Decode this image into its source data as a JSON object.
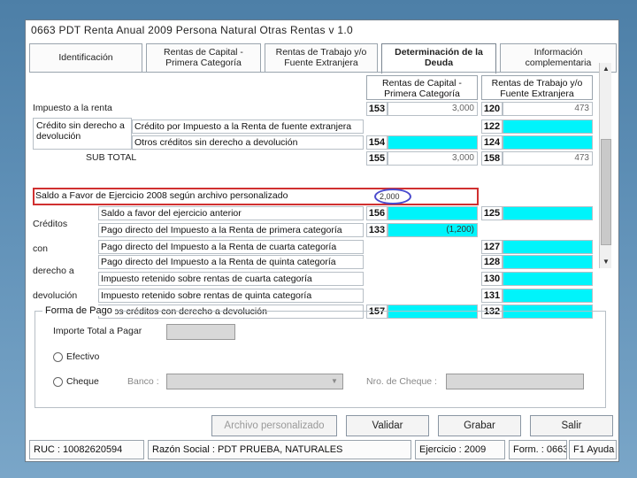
{
  "window": {
    "title": "0663 PDT Renta Anual 2009   Persona Natural   Otras Rentas   v 1.0"
  },
  "tabs": [
    {
      "label": "Identificación"
    },
    {
      "label": "Rentas de Capital - Primera Categoría"
    },
    {
      "label": "Rentas de Trabajo y/o Fuente Extranjera"
    },
    {
      "label": "Determinación de la Deuda"
    },
    {
      "label": "Información complementaria"
    }
  ],
  "columns": {
    "primera": "Rentas de Capital - Primera Categoría",
    "trabajo": "Rentas de Trabajo y/o Fuente Extranjera"
  },
  "impuesto": {
    "label": "Impuesto a la renta",
    "code1": "153",
    "value1": "3,000",
    "code2": "120",
    "value2": "473"
  },
  "credito_sin_derecho": {
    "group_label": "Crédito sin derecho a devolución",
    "rows": [
      {
        "label": "Crédito por Impuesto a la Renta de fuente extranjera",
        "code1": "",
        "value1": "",
        "code2": "122",
        "value2": ""
      },
      {
        "label": "Otros créditos sin derecho a devolución",
        "code1": "154",
        "value1": "",
        "code2": "124",
        "value2": ""
      }
    ]
  },
  "subtotal": {
    "label": "SUB TOTAL",
    "code1": "155",
    "value1": "3,000",
    "code2": "158",
    "value2": "473"
  },
  "saldo": {
    "label": "Saldo a Favor de Ejercicio 2008 según archivo personalizado",
    "value": "2,000"
  },
  "creditos_con_derecho": {
    "group_words": [
      "Créditos",
      "con",
      "derecho a",
      "devolución"
    ],
    "rows": [
      {
        "label": "Saldo a favor del ejercicio anterior",
        "code1": "156",
        "value1": "",
        "code2": "125",
        "value2": ""
      },
      {
        "label": "Pago directo del Impuesto a la Renta de primera categoría",
        "code1": "133",
        "value1": "(1,200)",
        "code2": "",
        "value2": ""
      },
      {
        "label": "Pago directo del Impuesto a la Renta de cuarta categoría",
        "code1": "",
        "value1": "",
        "code2": "127",
        "value2": ""
      },
      {
        "label": "Pago directo del Impuesto a la Renta de quinta categoría",
        "code1": "",
        "value1": "",
        "code2": "128",
        "value2": ""
      },
      {
        "label": "Impuesto retenido sobre rentas de cuarta categoría",
        "code1": "",
        "value1": "",
        "code2": "130",
        "value2": ""
      },
      {
        "label": "Impuesto retenido sobre rentas de quinta categoría",
        "code1": "",
        "value1": "",
        "code2": "131",
        "value2": ""
      },
      {
        "label": "Otros créditos con derecho a devolución",
        "code1": "157",
        "value1": "",
        "code2": "132",
        "value2": ""
      }
    ]
  },
  "forma_pago": {
    "legend": "Forma de Pago",
    "importe_label": "Importe Total a Pagar",
    "efectivo_label": "Efectivo",
    "cheque_label": "Cheque",
    "banco_label": "Banco :",
    "nro_cheque_label": "Nro. de Cheque :"
  },
  "buttons": {
    "archivo": "Archivo personalizado",
    "validar": "Validar",
    "grabar": "Grabar",
    "salir": "Salir"
  },
  "status": {
    "ruc": "RUC : 10082620594",
    "razon": "Razón Social : PDT PRUEBA, NATURALES",
    "ejercicio": "Ejercicio : 2009",
    "form": "Form. : 0663",
    "ayuda": "F1 Ayuda"
  },
  "colors": {
    "cyan_field": "#00f4fb",
    "highlight_border": "#d03030",
    "desktop": "#5e8fb6"
  }
}
